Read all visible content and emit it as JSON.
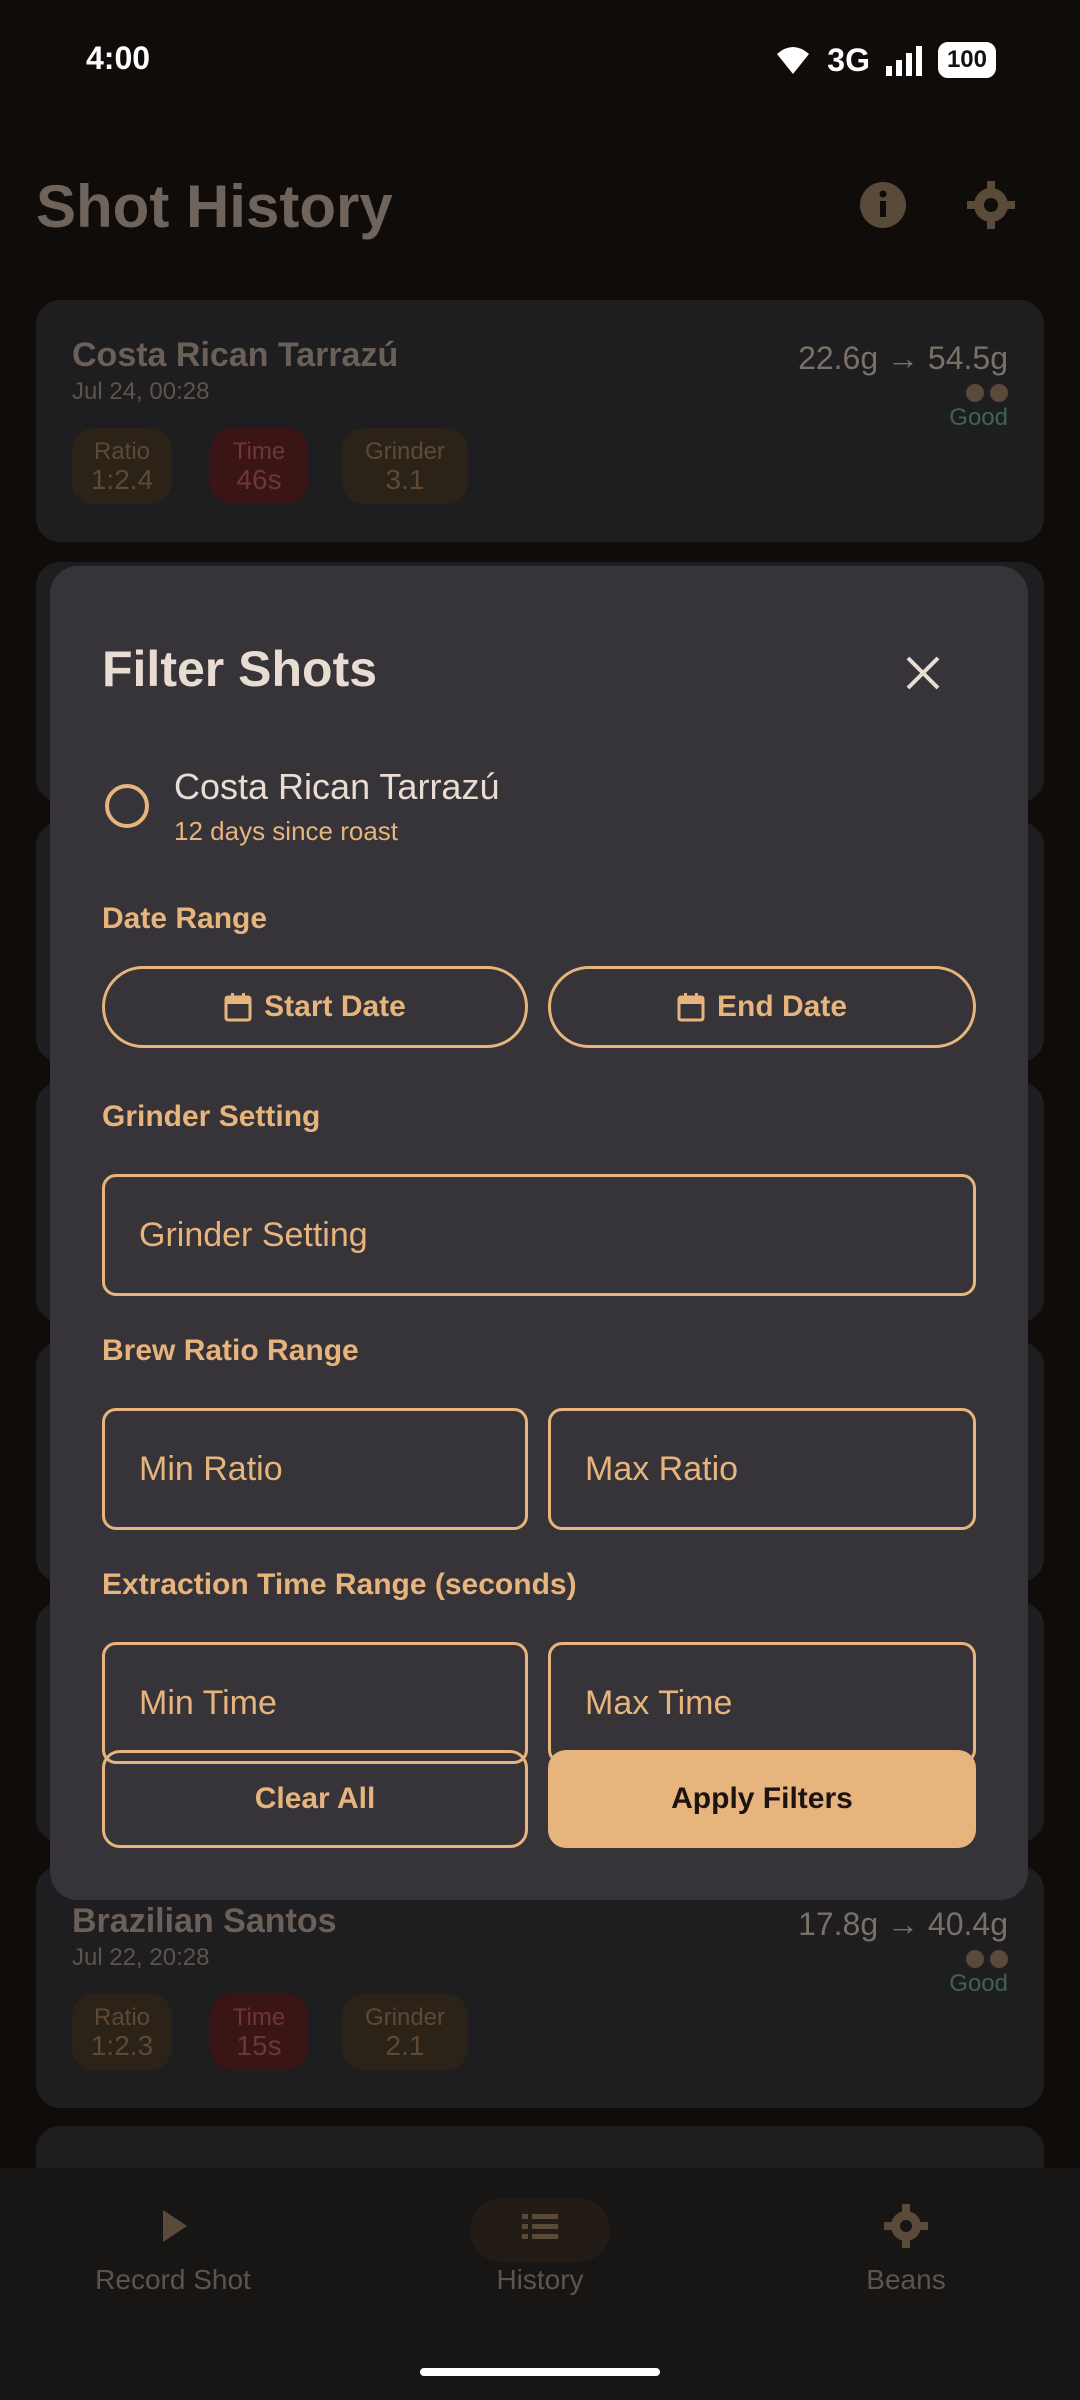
{
  "status": {
    "time": "4:00",
    "network": "3G",
    "battery": "100"
  },
  "header": {
    "title": "Shot History"
  },
  "cards": [
    {
      "name": "Costa Rican Tarrazú",
      "date": "Jul 24, 00:28",
      "weights": "22.6g → 54.5g",
      "rating": "Good",
      "chips": [
        {
          "label": "Ratio",
          "value": "1:2.4"
        },
        {
          "label": "Time",
          "value": "46s"
        },
        {
          "label": "Grinder",
          "value": "3.1"
        }
      ]
    },
    {
      "name": "Brazilian Santos",
      "date": "Jul 22, 20:28",
      "weights": "17.8g → 40.4g",
      "rating": "Good",
      "chips": [
        {
          "label": "Ratio",
          "value": "1:2.3"
        },
        {
          "label": "Time",
          "value": "15s"
        },
        {
          "label": "Grinder",
          "value": "2.1"
        }
      ]
    }
  ],
  "dialog": {
    "title": "Filter Shots",
    "bean": {
      "name": "Costa Rican Tarrazú",
      "subtitle": "12 days since roast"
    },
    "date_range": {
      "label": "Date Range",
      "start": "Start Date",
      "end": "End Date"
    },
    "grinder": {
      "label": "Grinder Setting",
      "placeholder": "Grinder Setting"
    },
    "ratio": {
      "label": "Brew Ratio Range",
      "min": "Min Ratio",
      "max": "Max Ratio"
    },
    "time": {
      "label": "Extraction Time Range (seconds)",
      "min": "Min Time",
      "max": "Max Time"
    },
    "clear_label": "Clear All",
    "apply_label": "Apply Filters"
  },
  "nav": {
    "items": [
      {
        "label": "Record Shot"
      },
      {
        "label": "History"
      },
      {
        "label": "Beans"
      }
    ]
  }
}
